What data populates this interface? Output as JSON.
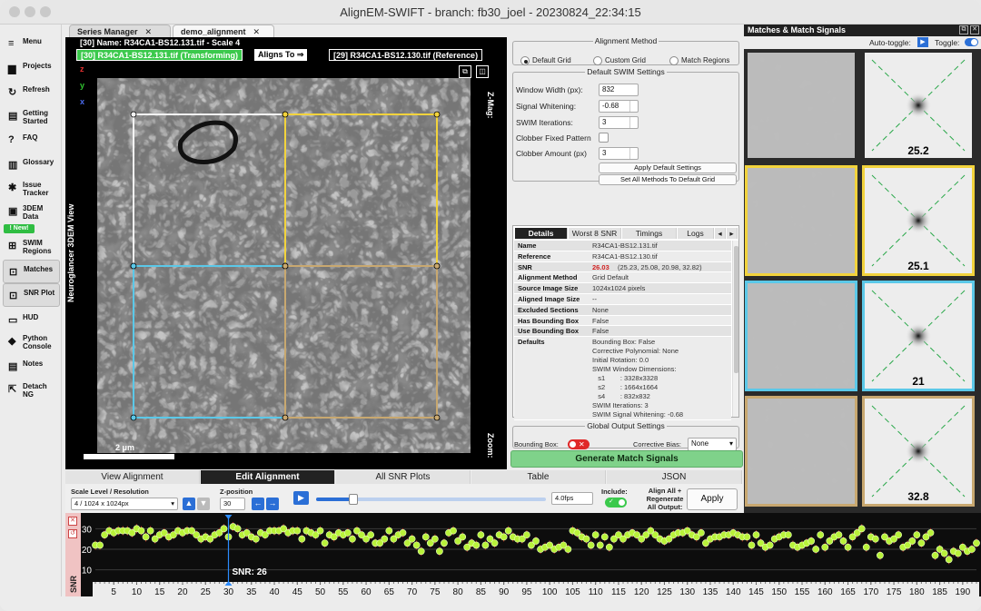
{
  "window": {
    "title": "AlignEM-SWIFT - branch: fb30_joel - 20230824_22:34:15"
  },
  "sidebar": [
    {
      "icon": "menu-icon",
      "glyph": "≡",
      "label": "Menu"
    },
    {
      "icon": "projects-icon",
      "glyph": "▆",
      "label": "Projects"
    },
    {
      "icon": "refresh-icon",
      "glyph": "↻",
      "label": "Refresh"
    },
    {
      "icon": "getting-started-icon",
      "glyph": "▤",
      "label": "Getting\nStarted"
    },
    {
      "icon": "faq-icon",
      "glyph": "?",
      "label": "FAQ"
    },
    {
      "icon": "glossary-icon",
      "glyph": "▥",
      "label": "Glossary"
    },
    {
      "icon": "issue-tracker-icon",
      "glyph": "✱",
      "label": "Issue\nTracker"
    },
    {
      "icon": "3dem-data-icon",
      "glyph": "▣",
      "label": "3DEM\nData"
    },
    {
      "icon": "swim-regions-icon",
      "glyph": "⊞",
      "label": "SWIM\nRegions"
    },
    {
      "icon": "matches-icon",
      "glyph": "⊡",
      "label": "Matches"
    },
    {
      "icon": "snr-plot-icon",
      "glyph": "⊡",
      "label": "SNR Plot"
    },
    {
      "icon": "hud-icon",
      "glyph": "▭",
      "label": "HUD"
    },
    {
      "icon": "python-console-icon",
      "glyph": "◆",
      "label": "Python\nConsole"
    },
    {
      "icon": "notes-icon",
      "glyph": "▤",
      "label": "Notes"
    },
    {
      "icon": "detach-ng-icon",
      "glyph": "⇱",
      "label": "Detach\nNG"
    }
  ],
  "new_badge": "! New!",
  "tabs": [
    {
      "label": "Series Manager"
    },
    {
      "label": "demo_alignment"
    }
  ],
  "viewer": {
    "header": "[30] Name: R34CA1-BS12.131.tif - Scale 4",
    "transforming": "[30] R34CA1-BS12.131.tif (Transforming)",
    "aligns_to": "Aligns To ⇒",
    "reference": "[29] R34CA1-BS12.130.tif (Reference)",
    "axes": [
      "z",
      "y",
      "x"
    ],
    "side_label": "Neuroglancer 3DEM View",
    "zmag": "Z-Mag:",
    "zoom": "Zoom:",
    "scalebar": "2 μm"
  },
  "colors": {
    "yellow": "#f2d33c",
    "cyan": "#5bc8e8",
    "white": "#f3f3f3",
    "tan": "#c8a870",
    "green": "#3bc94c",
    "snr_red": "#d12020"
  },
  "method": {
    "legend": "Alignment Method",
    "options": [
      "Default Grid",
      "Custom Grid",
      "Match Regions"
    ],
    "selected": "Default Grid"
  },
  "swim": {
    "legend": "Default SWIM Settings",
    "window_width_label": "Window Width (px):",
    "window_width": "832",
    "whitening_label": "Signal Whitening:",
    "whitening": "-0.68",
    "iterations_label": "SWIM Iterations:",
    "iterations": "3",
    "clobber_label": "Clobber Fixed Pattern",
    "clobber_amount_label": "Clobber Amount (px)",
    "clobber_amount": "3",
    "apply_btn": "Apply Default Settings",
    "set_all_btn": "Set All Methods To Default Grid"
  },
  "details_tabs": [
    "Details",
    "Worst 8 SNR",
    "Timings",
    "Logs"
  ],
  "details": [
    {
      "k": "Name",
      "v": "R34CA1-BS12.131.tif"
    },
    {
      "k": "Reference",
      "v": "R34CA1-BS12.130.tif"
    },
    {
      "k": "SNR",
      "v": "26.03",
      "extra": "(25.23, 25.08, 20.98, 32.82)"
    },
    {
      "k": "Alignment Method",
      "v": "Grid Default"
    },
    {
      "k": "Source Image Size",
      "v": "1024x1024 pixels"
    },
    {
      "k": "Aligned Image Size",
      "v": "--"
    },
    {
      "k": "Excluded Sections",
      "v": "None"
    },
    {
      "k": "Has Bounding Box",
      "v": "False"
    },
    {
      "k": "Use Bounding Box",
      "v": "False"
    }
  ],
  "defaults": {
    "k": "Defaults",
    "lines": [
      "Bounding Box: False",
      "Corrective Polynomial: None",
      "Initial Rotation: 0.0",
      "SWIM Window Dimensions:",
      "   s1        : 3328x3328",
      "   s2        : 1664x1664",
      "   s4        : 832x832",
      "SWIM Iterations: 3",
      "SWIM Signal Whitening: -0.68"
    ]
  },
  "output": {
    "legend": "Global Output Settings",
    "bbox_label": "Bounding Box:",
    "bias_label": "Corrective Bias:",
    "bias": "None"
  },
  "generate_btn": "Generate Match Signals",
  "bottom_tabs": [
    "View Alignment",
    "Edit Alignment",
    "All SNR Plots",
    "Table",
    "JSON"
  ],
  "controls": {
    "scale_label": "Scale Level / Resolution",
    "scale": "4 / 1024 x 1024px",
    "zpos_label": "Z-position",
    "zpos": "30",
    "fps": "4.0fps",
    "include_label": "Include:",
    "align_all_label": "Align All +\nRegenerate\nAll Output:",
    "apply_btn": "Apply"
  },
  "matches": {
    "title": "Matches & Match Signals",
    "autotoggle": "Auto-toggle:",
    "toggle": "Toggle:",
    "snr": [
      "25.2",
      "25.1",
      "21",
      "32.8"
    ]
  },
  "plot": {
    "ylabel": "SNR",
    "yticks": [
      10,
      20,
      30
    ],
    "xticks": [
      5,
      10,
      15,
      20,
      25,
      30,
      35,
      40,
      45,
      50,
      55,
      60,
      65,
      70,
      75,
      80,
      85,
      90,
      95,
      100,
      105,
      110,
      115,
      120,
      125,
      130,
      135,
      140,
      145,
      150,
      155,
      160,
      165,
      170,
      175,
      180,
      185,
      190
    ],
    "cursor_label": "SNR: 26",
    "cursor_x": 30
  },
  "chart_data": {
    "type": "scatter",
    "ylabel": "SNR",
    "xlim": [
      1,
      193
    ],
    "ylim": [
      5,
      35
    ],
    "values": [
      22,
      22,
      27,
      29,
      28,
      29,
      29,
      29,
      28,
      30,
      29,
      26,
      29,
      25,
      27,
      28,
      26,
      27,
      29,
      28,
      29,
      29,
      27,
      25,
      26,
      25,
      27,
      28,
      30,
      26,
      31,
      30,
      27,
      28,
      26,
      25,
      28,
      27,
      29,
      29,
      29,
      30,
      28,
      29,
      29,
      25,
      29,
      28,
      27,
      29,
      23,
      27,
      26,
      28,
      27,
      28,
      25,
      29,
      27,
      25,
      27,
      23,
      23,
      25,
      29,
      25,
      27,
      28,
      23,
      25,
      22,
      19,
      26,
      23,
      25,
      19,
      23,
      28,
      29,
      24,
      26,
      21,
      23,
      22,
      27,
      22,
      25,
      23,
      27,
      26,
      29,
      26,
      25,
      25,
      27,
      22,
      24,
      20,
      21,
      22,
      20,
      21,
      22,
      20,
      29,
      28,
      26,
      25,
      22,
      27,
      22,
      26,
      21,
      25,
      27,
      25,
      27,
      28,
      27,
      25,
      27,
      29,
      27,
      25,
      24,
      25,
      27,
      28,
      28,
      29,
      27,
      26,
      28,
      23,
      25,
      26,
      26,
      27,
      27,
      28,
      27,
      26,
      26,
      22,
      27,
      23,
      21,
      22,
      25,
      26,
      27,
      27,
      22,
      21,
      22,
      23,
      24,
      20,
      27,
      21,
      24,
      26,
      27,
      24,
      21,
      26,
      28,
      30,
      21,
      26,
      25,
      17,
      26,
      24,
      25,
      27,
      21,
      22,
      24,
      27,
      23,
      26,
      28,
      17,
      20,
      18,
      15,
      19,
      18,
      21,
      19,
      20,
      23
    ]
  }
}
